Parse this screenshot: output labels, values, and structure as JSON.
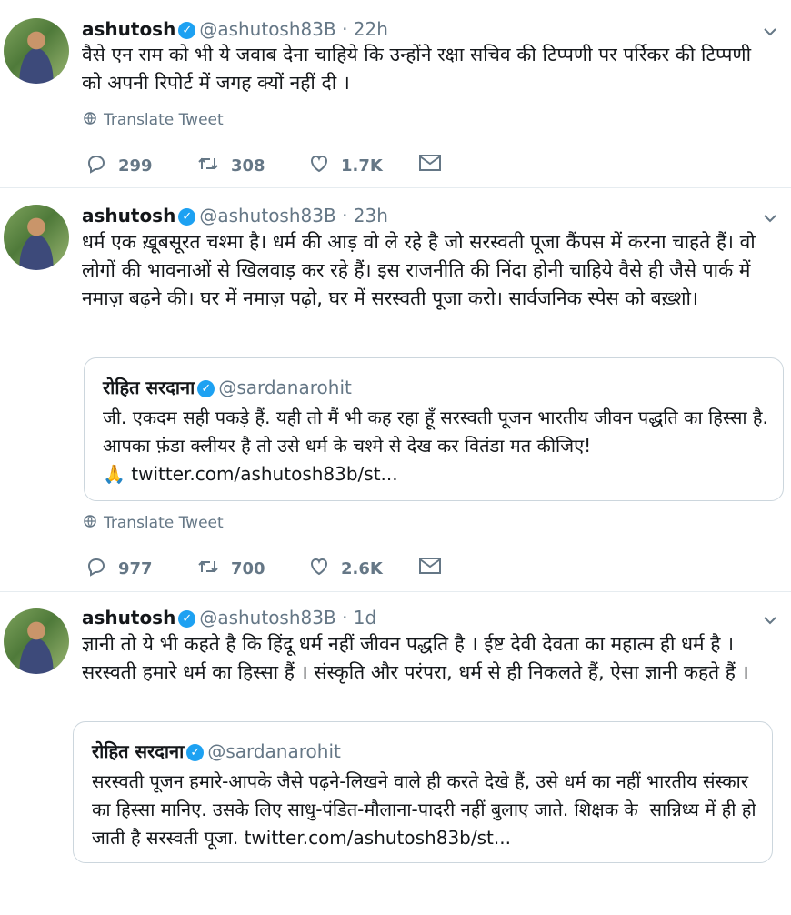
{
  "tweets": [
    {
      "name": "ashutosh",
      "handle": "@ashutosh83B",
      "dot": "·",
      "time": "22h",
      "text": "वैसे एन राम को भी ये जवाब देना चाहिये कि उन्होंने रक्षा सचिव की टिप्पणी पर पर्रिकर की टिप्पणी को अपनी रिपोर्ट में जगह क्यों नहीं दी ।",
      "translate": "Translate Tweet",
      "replies": "299",
      "retweets": "308",
      "likes": "1.7K"
    },
    {
      "name": "ashutosh",
      "handle": "@ashutosh83B",
      "dot": "·",
      "time": "23h",
      "text": "धर्म एक ख़ूबसूरत चश्मा है। धर्म की आड़ वो ले रहे है जो सरस्वती पूजा कैंपस में करना चाहते हैं। वो लोगों की भावनाओं से खिलवाड़ कर रहे हैं। इस राजनीति की निंदा होनी चाहिये वैसे ही जैसे पार्क में नमाज़ बढ़ने की। घर में नमाज़ पढ़ो, घर में सरस्वती पूजा करो। सार्वजनिक स्पेस को बख़्शो।",
      "quote": {
        "name": "रोहित सरदाना",
        "handle": "@sardanarohit",
        "text": "जी. एकदम सही पकड़े हैं. यही तो मैं भी कह रहा हूँ सरस्वती पूजन भारतीय जीवन पद्धति का हिस्सा है. आपका फ़ंडा क्लीयर है तो उसे धर्म के चश्मे से देख कर वितंडा मत कीजिए!",
        "emoji": "🙏",
        "link": "twitter.com/ashutosh83b/st..."
      },
      "translate": "Translate Tweet",
      "replies": "977",
      "retweets": "700",
      "likes": "2.6K"
    },
    {
      "name": "ashutosh",
      "handle": "@ashutosh83B",
      "dot": "·",
      "time": "1d",
      "text": "ज्ञानी तो ये भी कहते है कि हिंदू धर्म नहीं जीवन पद्धति है । ईष्ट देवी देवता का महात्म ही धर्म है । सरस्वती हमारे धर्म का हिस्सा हैं । संस्कृति और परंपरा, धर्म से ही निकलते हैं, ऐसा ज्ञानी कहते हैं ।",
      "quote": {
        "name": "रोहित सरदाना",
        "handle": "@sardanarohit",
        "text": "सरस्वती पूजन हमारे-आपके जैसे पढ़ने-लिखने वाले ही करते देखे हैं, उसे धर्म का नहीं भारतीय संस्कार का हिस्सा मानिए. उसके लिए साधु-पंडित-मौलाना-पादरी नहीं बुलाए जाते. शिक्षक के  सान्निध्य में ही हो जाती है सरस्वती पूजा.",
        "link": "twitter.com/ashutosh83b/st..."
      }
    }
  ],
  "icons": {
    "verified": "verified-badge-icon",
    "reply": "reply-icon",
    "retweet": "retweet-icon",
    "like": "heart-icon",
    "dm": "envelope-icon",
    "more": "chevron-down-icon",
    "translate": "globe-icon"
  },
  "colors": {
    "verified": "#1da1f2",
    "muted": "#657786",
    "border": "#ccd6dd"
  }
}
